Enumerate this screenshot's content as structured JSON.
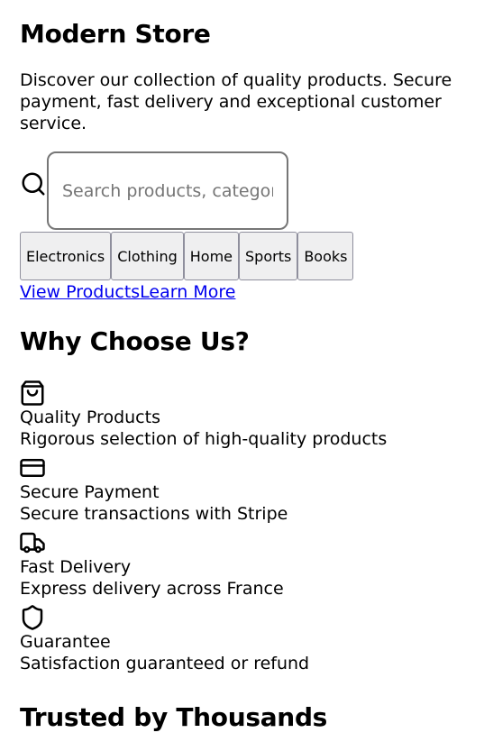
{
  "header": {
    "title": "Modern Store",
    "intro": "Discover our collection of quality products. Secure payment, fast delivery and exceptional customer service."
  },
  "search": {
    "icon": "search-icon",
    "placeholder": "Search products, categories..."
  },
  "categories": [
    "Electronics",
    "Clothing",
    "Home",
    "Sports",
    "Books"
  ],
  "links": {
    "view_products": "View Products",
    "learn_more": "Learn More"
  },
  "why": {
    "title": "Why Choose Us?",
    "features": [
      {
        "icon": "shopping-bag-icon",
        "title": "Quality Products",
        "description": "Rigorous selection of high-quality products"
      },
      {
        "icon": "credit-card-icon",
        "title": "Secure Payment",
        "description": "Secure transactions with Stripe"
      },
      {
        "icon": "truck-icon",
        "title": "Fast Delivery",
        "description": "Express delivery across France"
      },
      {
        "icon": "shield-icon",
        "title": "Guarantee",
        "description": "Satisfaction guaranteed or refund"
      }
    ]
  },
  "trust": {
    "title": "Trusted by Thousands"
  }
}
